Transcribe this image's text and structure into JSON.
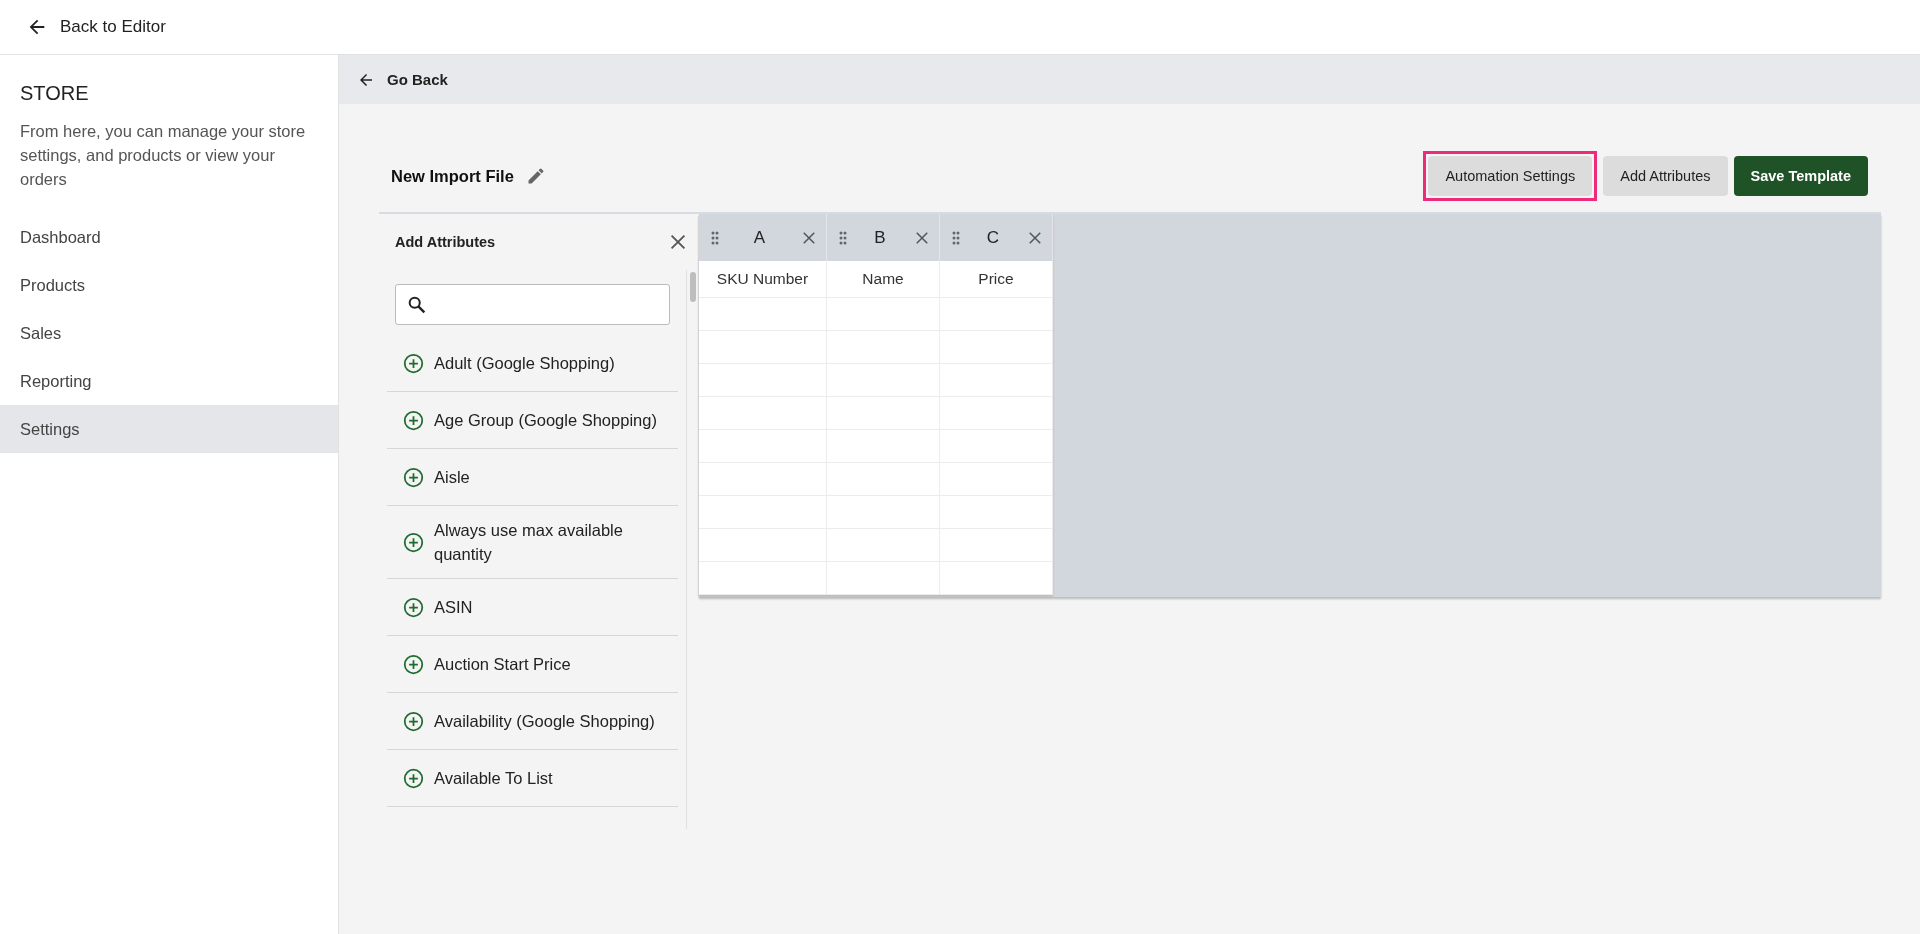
{
  "header": {
    "back_link": "Back to Editor"
  },
  "sidebar": {
    "title": "STORE",
    "description": "From here, you can manage your store settings, and products or view your orders",
    "items": [
      {
        "label": "Dashboard",
        "selected": false
      },
      {
        "label": "Products",
        "selected": false
      },
      {
        "label": "Sales",
        "selected": false
      },
      {
        "label": "Reporting",
        "selected": false
      },
      {
        "label": "Settings",
        "selected": true
      }
    ]
  },
  "subheader": {
    "back_link": "Go Back"
  },
  "file_title": "New Import File",
  "buttons": [
    {
      "label": "Automation Settings",
      "kind": "secondary",
      "highlighted": true
    },
    {
      "label": "Add Attributes",
      "kind": "secondary",
      "highlighted": false
    },
    {
      "label": "Save Template",
      "kind": "primary",
      "highlighted": false
    }
  ],
  "attributes_panel": {
    "title": "Add Attributes",
    "items": [
      {
        "label": "Adult (Google Shopping)"
      },
      {
        "label": "Age Group (Google Shopping)"
      },
      {
        "label": "Aisle"
      },
      {
        "label": "Always use max available quantity"
      },
      {
        "label": "ASIN"
      },
      {
        "label": "Auction Start Price"
      },
      {
        "label": "Availability (Google Shopping)"
      },
      {
        "label": "Available To List"
      }
    ]
  },
  "table": {
    "columns": [
      {
        "letter": "A",
        "heading": "SKU Number"
      },
      {
        "letter": "B",
        "heading": "Name"
      },
      {
        "letter": "C",
        "heading": "Price"
      }
    ]
  }
}
